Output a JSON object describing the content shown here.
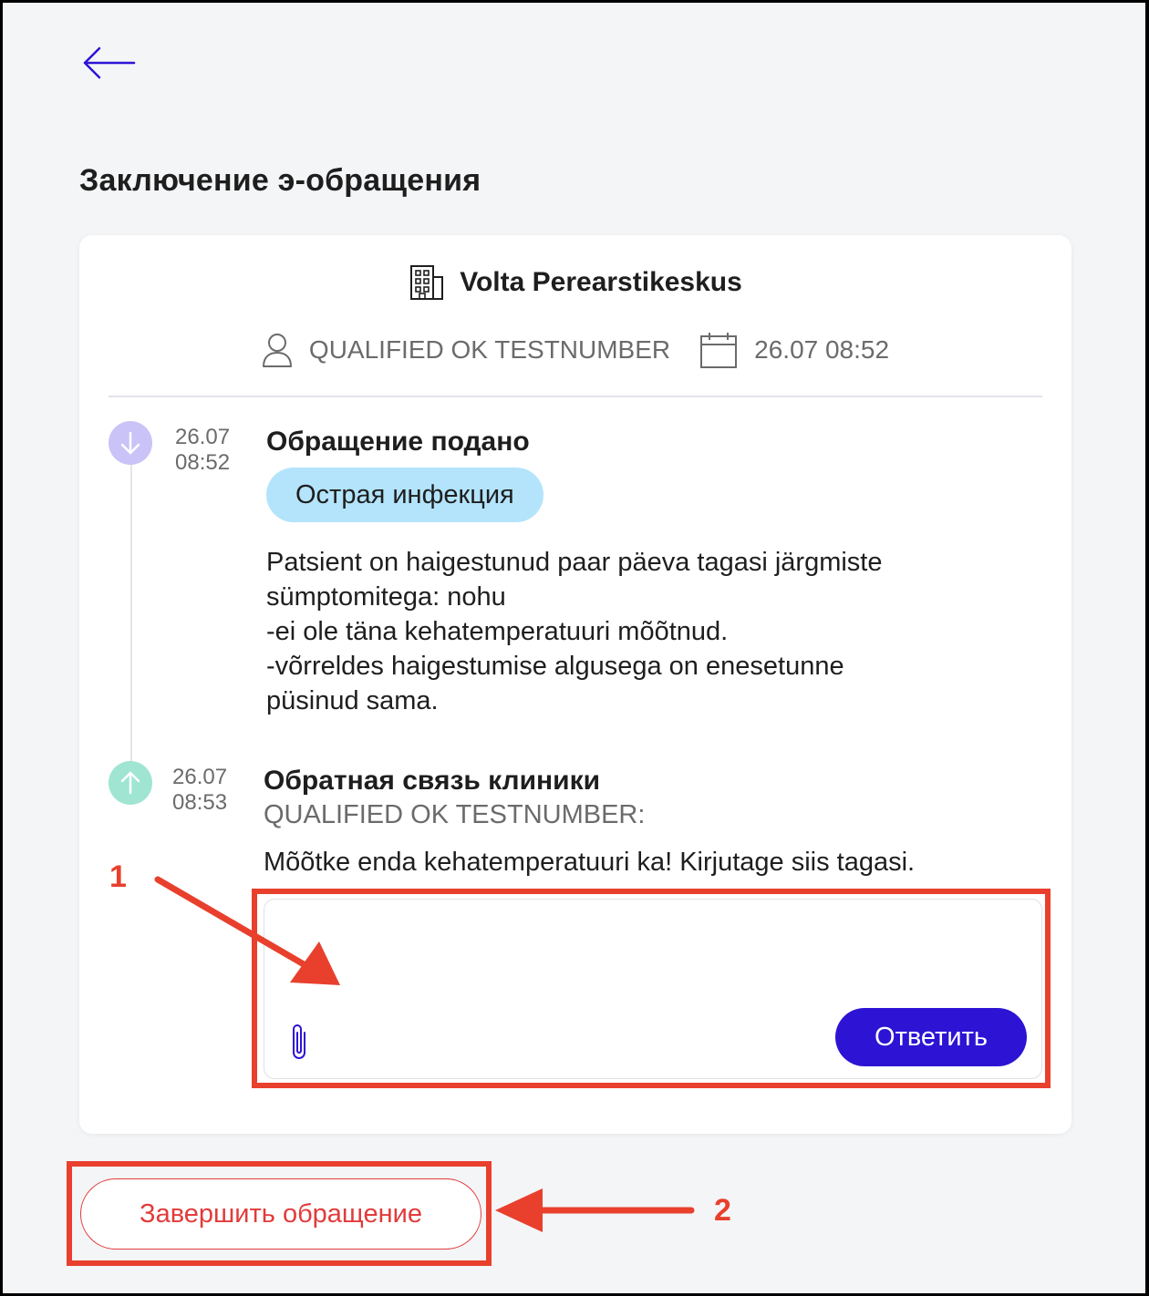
{
  "page": {
    "title": "Заключение э-обращения"
  },
  "case": {
    "clinic_name": "Volta Perearstikeskus",
    "doctor": "QUALIFIED OK TESTNUMBER",
    "datetime": "26.07 08:52"
  },
  "timeline": {
    "submitted": {
      "date": "26.07",
      "time": "08:52",
      "title": "Обращение подано",
      "tag": "Острая инфекция",
      "message": "Patsient on haigestunud paar päeva tagasi järgmiste\nsümptomitega: nohu\n-ei ole täna kehatemperatuuri mõõtnud.\n-võrreldes haigestumise algusega on enesetunne\npüsinud sama."
    },
    "feedback": {
      "date": "26.07",
      "time": "08:53",
      "title": "Обратная связь клиники",
      "author": "QUALIFIED OK TESTNUMBER:",
      "text": "Mõõtke enda kehatemperatuuri ka! Kirjutage siis tagasi."
    }
  },
  "reply": {
    "value": "",
    "button_label": "Ответить"
  },
  "actions": {
    "finish_label": "Завершить обращение"
  },
  "annotations": {
    "label_1": "1",
    "label_2": "2"
  },
  "colors": {
    "accent": "#2d14d4",
    "danger": "#e23b3b",
    "annotation": "#e8402d",
    "tag_bg": "#b3e4fb",
    "incoming_dot": "#c9c3f7",
    "outgoing_dot": "#9fe5d2"
  },
  "icons": {
    "back": "arrow-left-icon",
    "clinic": "building-icon",
    "doctor": "person-icon",
    "date": "calendar-icon",
    "incoming": "arrow-down-icon",
    "outgoing": "arrow-up-icon",
    "attach": "paperclip-icon"
  }
}
